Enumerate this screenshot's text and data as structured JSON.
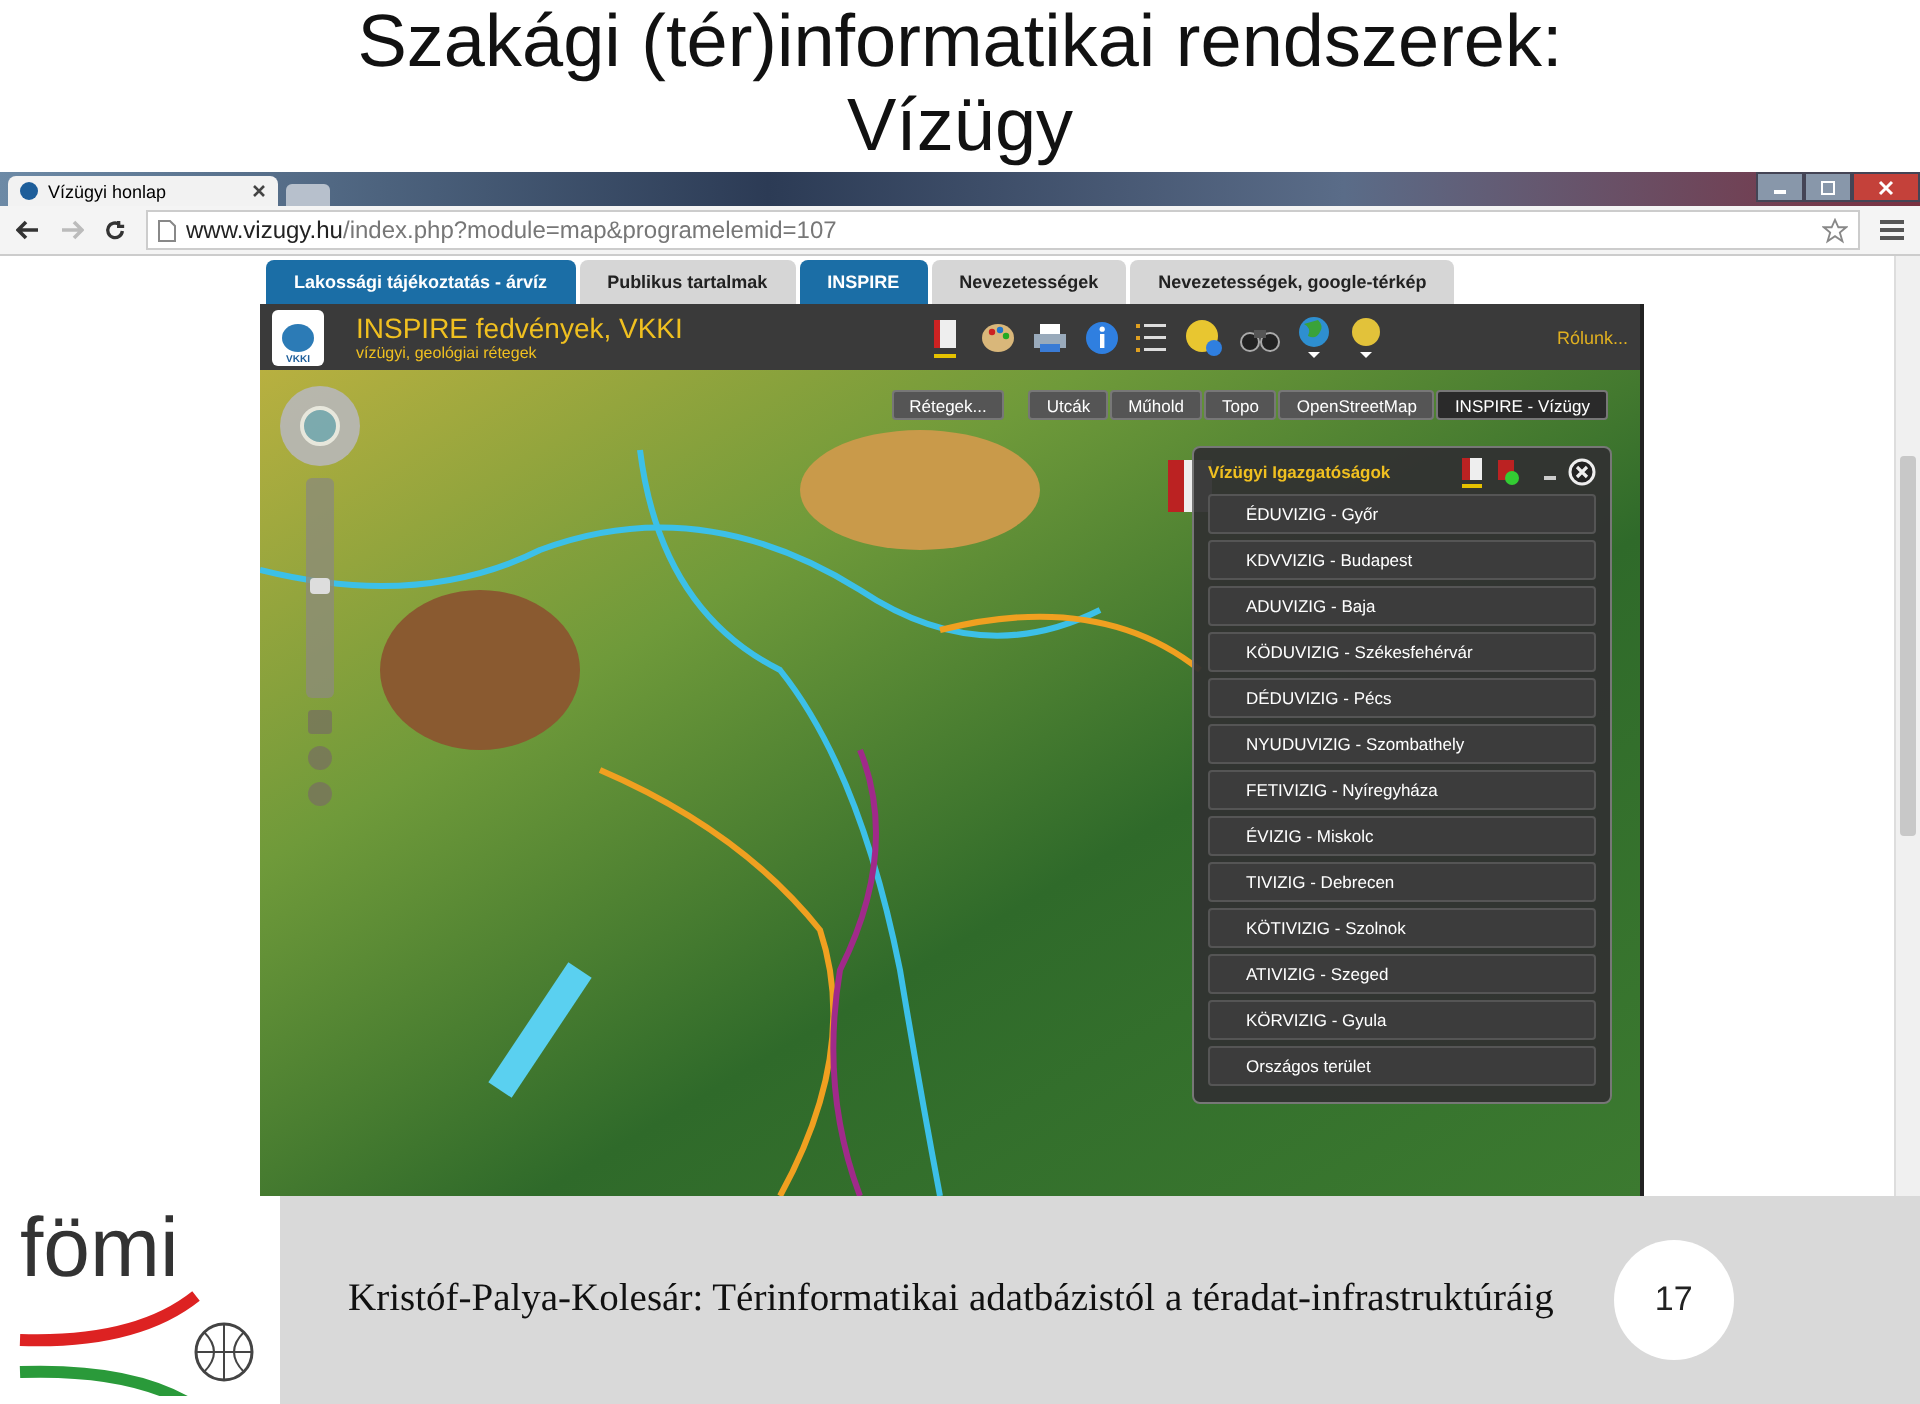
{
  "slide": {
    "title_lines": [
      "Szakági (tér)informatikai rendszerek:",
      "Vízügy"
    ]
  },
  "browser": {
    "tab_title": "Vízügyi honlap",
    "url_domain": "www.vizugy.hu",
    "url_path": "/index.php?module=map&programelemid=107"
  },
  "site_tabs": [
    {
      "label": "Lakossági tájékoztatás - árvíz",
      "color": "#1b6ea6"
    },
    {
      "label": "Publikus tartalmak",
      "color": "#d6d6d6"
    },
    {
      "label": "INSPIRE",
      "color": "#1b6ea6"
    },
    {
      "label": "Nevezetességek",
      "color": "#d6d6d6"
    },
    {
      "label": "Nevezetességek, google-térkép",
      "color": "#d6d6d6"
    }
  ],
  "app": {
    "logo_text": "VKKI",
    "title": "INSPIRE fedvények, VKKI",
    "subtitle": "vízügyi, geológiai rétegek",
    "about": "Rólunk..."
  },
  "zoom": {
    "level": 0.5
  },
  "layers_button": "Rétegek...",
  "basemaps": [
    {
      "label": "Utcák",
      "selected": false
    },
    {
      "label": "Műhold",
      "selected": false
    },
    {
      "label": "Topo",
      "selected": false
    },
    {
      "label": "OpenStreetMap",
      "selected": false
    },
    {
      "label": "INSPIRE - Vízügy",
      "selected": true
    }
  ],
  "panel": {
    "title": "Vízügyi Igazgatóságok",
    "items": [
      "ÉDUVIZIG - Győr",
      "KDVVIZIG - Budapest",
      "ADUVIZIG - Baja",
      "KÖDUVIZIG - Székesfehérvár",
      "DÉDUVIZIG - Pécs",
      "NYUDUVIZIG - Szombathely",
      "FETIVIZIG - Nyíregyháza",
      "ÉVIZIG - Miskolc",
      "TIVIZIG - Debrecen",
      "KÖTIVIZIG - Szolnok",
      "ATIVIZIG - Szeged",
      "KÖRVIZIG - Gyula",
      "Országos terület"
    ]
  },
  "footer": {
    "logo_text": "fömi",
    "caption": "Kristóf-Palya-Kolesár: Térinformatikai adatbázistól a téradat-infrastruktúráig",
    "page_number": "17"
  }
}
